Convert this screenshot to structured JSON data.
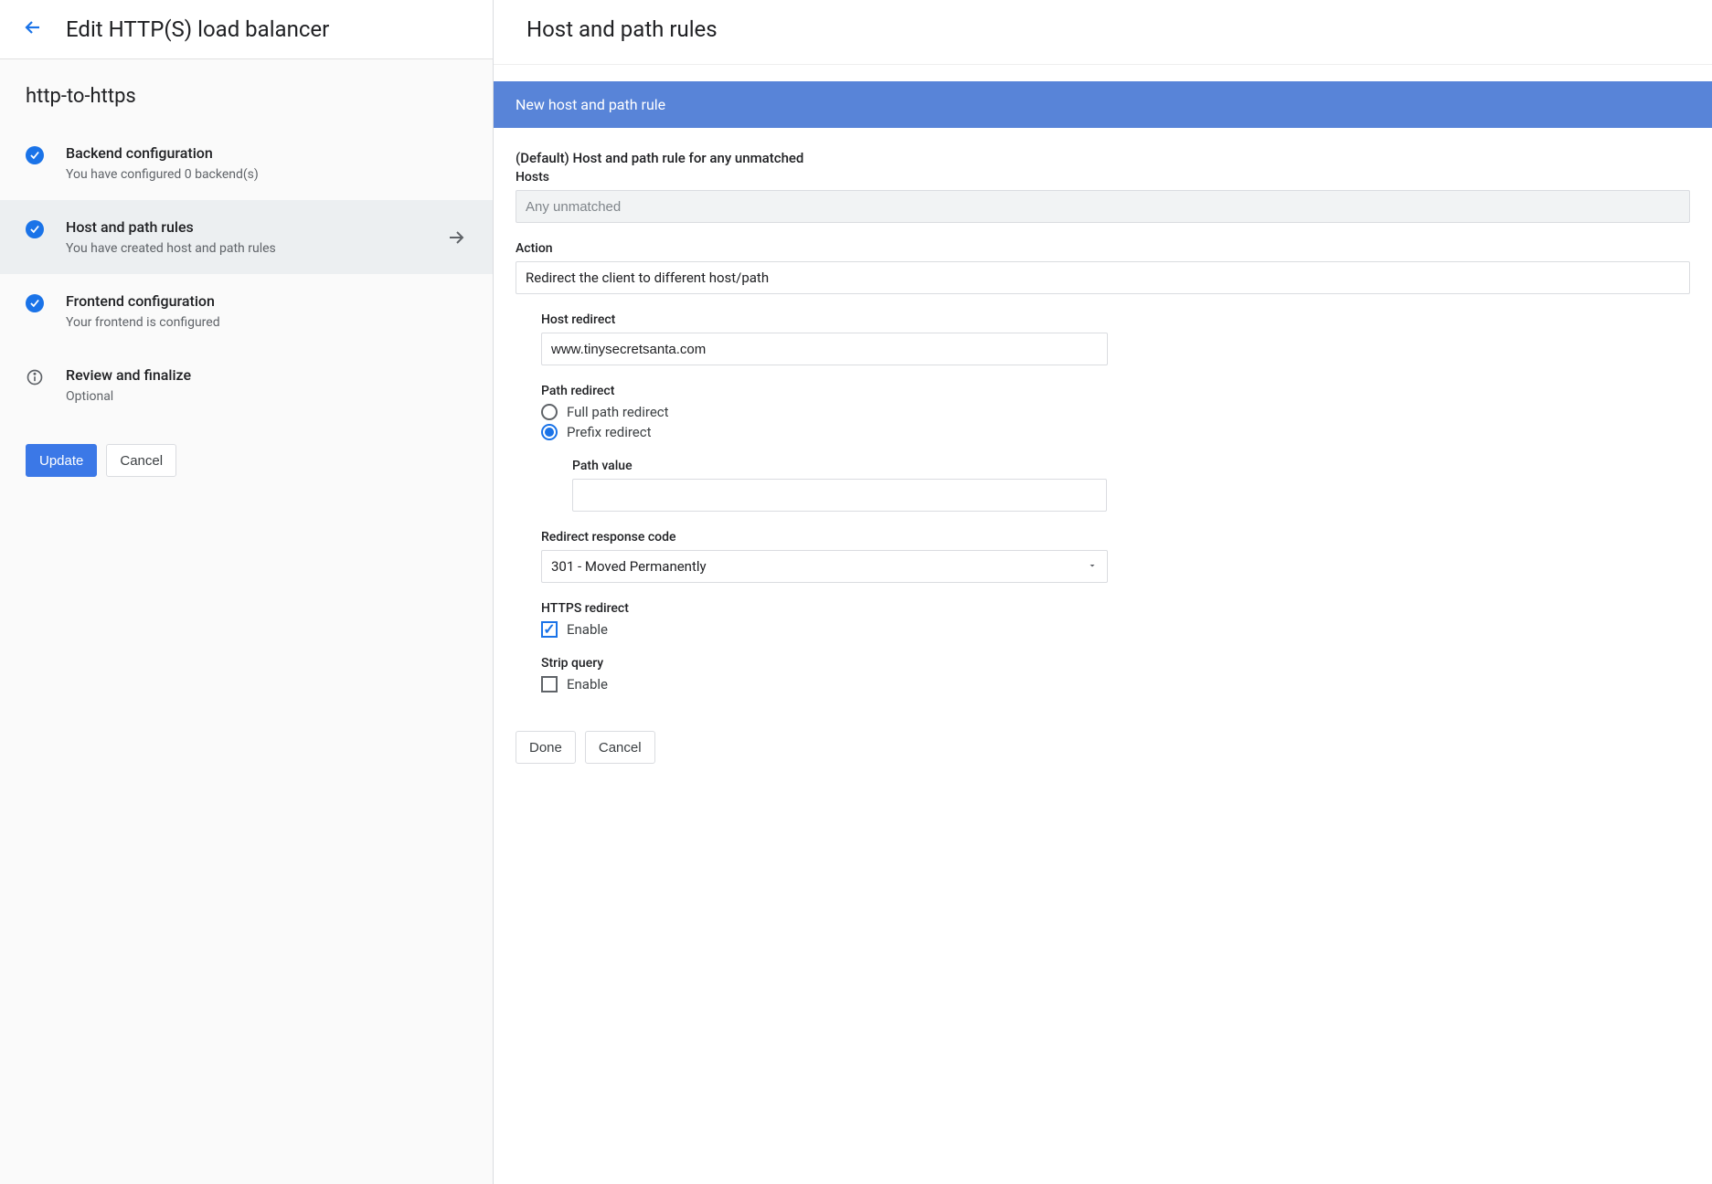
{
  "page_title": "Edit HTTP(S) load balancer",
  "lb_name": "http-to-https",
  "steps": {
    "backend": {
      "title": "Backend configuration",
      "sub": "You have configured 0 backend(s)"
    },
    "hostpath": {
      "title": "Host and path rules",
      "sub": "You have created host and path rules"
    },
    "frontend": {
      "title": "Frontend configuration",
      "sub": "Your frontend is configured"
    },
    "review": {
      "title": "Review and finalize",
      "sub": "Optional"
    }
  },
  "left_actions": {
    "update": "Update",
    "cancel": "Cancel"
  },
  "right_title": "Host and path rules",
  "banner": "New host and path rule",
  "default_rule_title": "(Default) Host and path rule for any unmatched",
  "hosts": {
    "label": "Hosts",
    "placeholder": "Any unmatched",
    "value": ""
  },
  "action": {
    "label": "Action",
    "value": "Redirect the client to different host/path"
  },
  "host_redirect": {
    "label": "Host redirect",
    "value": "www.tinysecretsanta.com"
  },
  "path_redirect": {
    "label": "Path redirect",
    "options": {
      "full": "Full path redirect",
      "prefix": "Prefix redirect"
    }
  },
  "path_value": {
    "label": "Path value",
    "value": ""
  },
  "response_code": {
    "label": "Redirect response code",
    "value": "301 - Moved Permanently"
  },
  "https_redirect": {
    "label": "HTTPS redirect",
    "option": "Enable"
  },
  "strip_query": {
    "label": "Strip query",
    "option": "Enable"
  },
  "right_actions": {
    "done": "Done",
    "cancel": "Cancel"
  }
}
